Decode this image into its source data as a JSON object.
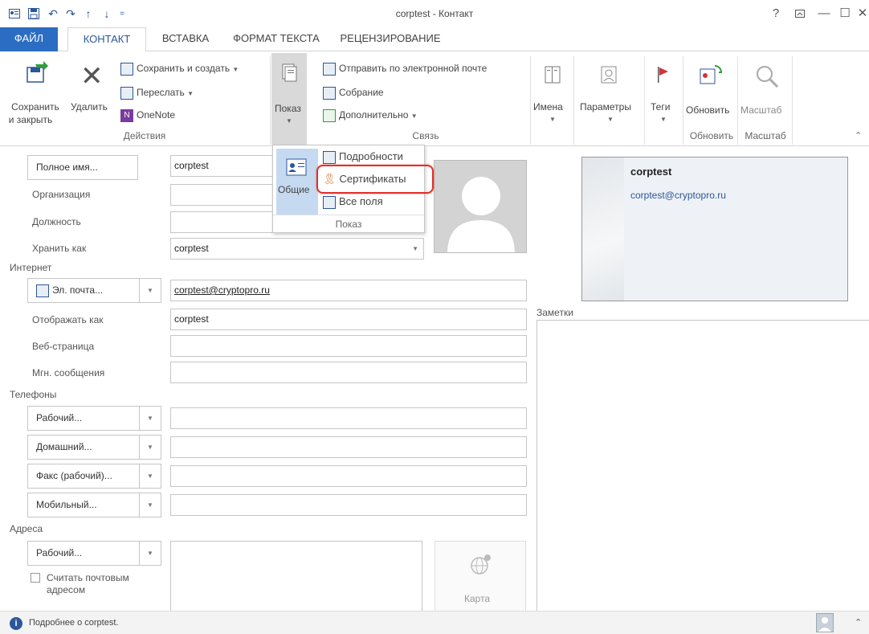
{
  "window": {
    "title": "corptest - Контакт",
    "help": "?",
    "restore_ribbon": "⊼",
    "minimize": "—",
    "maximize": "☐",
    "close": "✕"
  },
  "tabs": [
    {
      "label": "ФАЙЛ"
    },
    {
      "label": "КОНТАКТ"
    },
    {
      "label": "ВСТАВКА"
    },
    {
      "label": "ФОРМАТ ТЕКСТА"
    },
    {
      "label": "РЕЦЕНЗИРОВАНИЕ"
    }
  ],
  "ribbon": {
    "actions": {
      "save_close_1": "Сохранить",
      "save_close_2": "и закрыть",
      "delete": "Удалить",
      "save_new": "Сохранить и создать",
      "forward": "Переслать",
      "onenote": "OneNote",
      "group": "Действия"
    },
    "show": {
      "label": "Показ"
    },
    "comm": {
      "email": "Отправить по электронной почте",
      "meeting": "Собрание",
      "more": "Дополнительно",
      "group": "Связь"
    },
    "names": "Имена",
    "options": "Параметры",
    "tags": "Теги",
    "update": "Обновить",
    "update_group": "Обновить",
    "zoom": "Масштаб",
    "zoom_group": "Масштаб"
  },
  "show_menu": {
    "general": "Общие",
    "details": "Подробности",
    "certificates": "Сертификаты",
    "all_fields": "Все поля",
    "group": "Показ"
  },
  "form": {
    "full_name_btn": "Полное имя...",
    "full_name": "corptest",
    "company_label": "Организация",
    "job_label": "Должность",
    "file_as_label": "Хранить как",
    "file_as": "corptest",
    "internet_section": "Интернет",
    "email_btn": "Эл. почта...",
    "email": "corptest@cryptopro.ru",
    "display_as_label": "Отображать как",
    "display_as": "corptest",
    "web_label": "Веб-страница",
    "im_label": "Мгн. сообщения",
    "phones_section": "Телефоны",
    "phone_work": "Рабочий...",
    "phone_home": "Домашний...",
    "phone_fax": "Факс (рабочий)...",
    "phone_mobile": "Мобильный...",
    "address_section": "Адреса",
    "address_work": "Рабочий...",
    "mailing_1": "Считать почтовым",
    "mailing_2": "адресом",
    "map": "Карта",
    "notes_label": "Заметки"
  },
  "card": {
    "name": "corptest",
    "email": "corptest@cryptopro.ru"
  },
  "status": {
    "text": "Подробнее о corptest."
  },
  "colors": {
    "accent": "#2b579a",
    "file_tab": "#2b6dc2",
    "highlight_ring": "#e0302a",
    "selected": "#c5daf1"
  }
}
